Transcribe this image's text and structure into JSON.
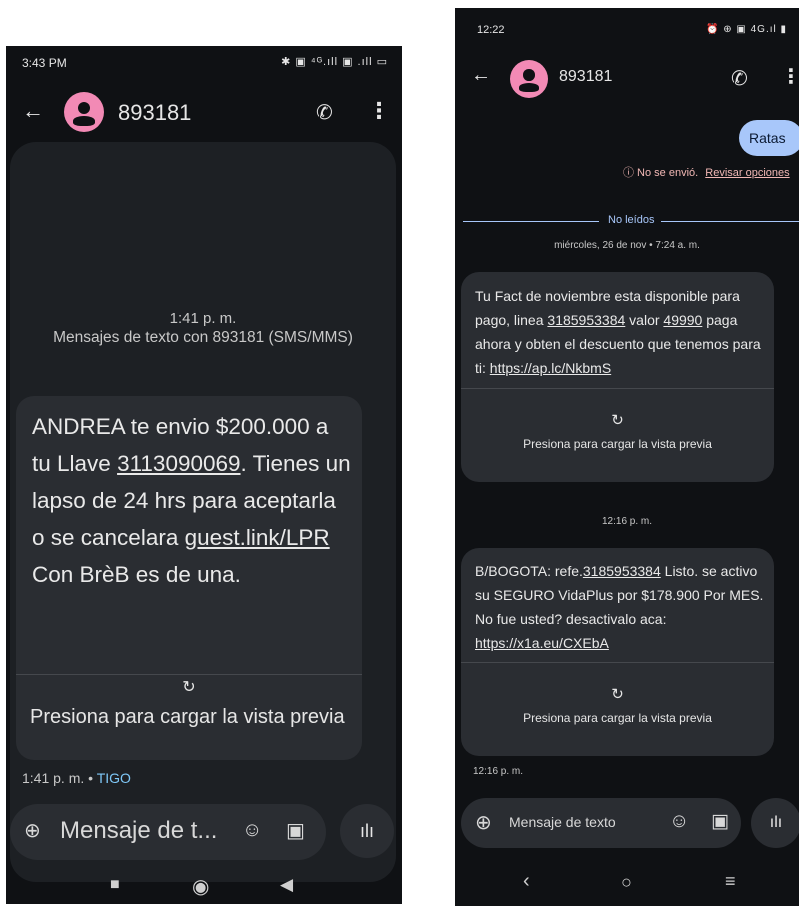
{
  "left": {
    "status": {
      "time": "3:43 PM",
      "icons": "✱ ▣ ⁴ᴳ.ıll ▣ .ıll ▭"
    },
    "header": {
      "contact": "893181"
    },
    "thread": {
      "timestamp": "1:41 p. m.",
      "info": "Mensajes de texto con 893181 (SMS/MMS)",
      "message": {
        "part1": "ANDREA te envio $200.000 a tu Llave ",
        "phone_link": "3113090069",
        "part2": ". Tienes un lapso de 24 hrs para aceptarla o se cancelara ",
        "url_link": "guest.link/LPR",
        "part3": " Con BrèB es de una."
      },
      "preview_label": "Presiona para cargar la vista previa",
      "meta_time": "1:41 p. m.",
      "meta_sep": " • ",
      "meta_carrier": "TIGO"
    },
    "composer": {
      "placeholder": "Mensaje de t..."
    }
  },
  "right": {
    "status": {
      "time": "12:22",
      "icons": "⏰ ⊕ ▣ 4G.ıl ▮"
    },
    "header": {
      "contact": "893181"
    },
    "sent_message": "Ratas",
    "error": {
      "text": "ⓘ No se envió.",
      "link": "Revisar opciones"
    },
    "unread_label": "No leídos",
    "date_label": "miércoles, 26 de nov • 7:24 a. m.",
    "message1": {
      "part1": "Tu Fact de noviembre esta disponible para pago, linea ",
      "phone_link": "3185953384",
      "part2": " valor ",
      "amount_link": "49990",
      "part3": " paga ahora y obten el descuento que tenemos para ti: ",
      "url_link": "https://ap.lc/NkbmS"
    },
    "preview_label_1": "Presiona para cargar la vista previa",
    "time_label": "12:16 p. m.",
    "message2": {
      "part1": "B/BOGOTA: refe.",
      "phone_link": "3185953384",
      "part2": " Listo. se activo su SEGURO VidaPlus por $178.900 Por MES. No fue usted? desactivalo aca: ",
      "url_link": "https://x1a.eu/CXEbA"
    },
    "preview_label_2": "Presiona para cargar la vista previa",
    "meta_time": "12:16 p. m.",
    "composer": {
      "placeholder": "Mensaje de texto"
    }
  }
}
